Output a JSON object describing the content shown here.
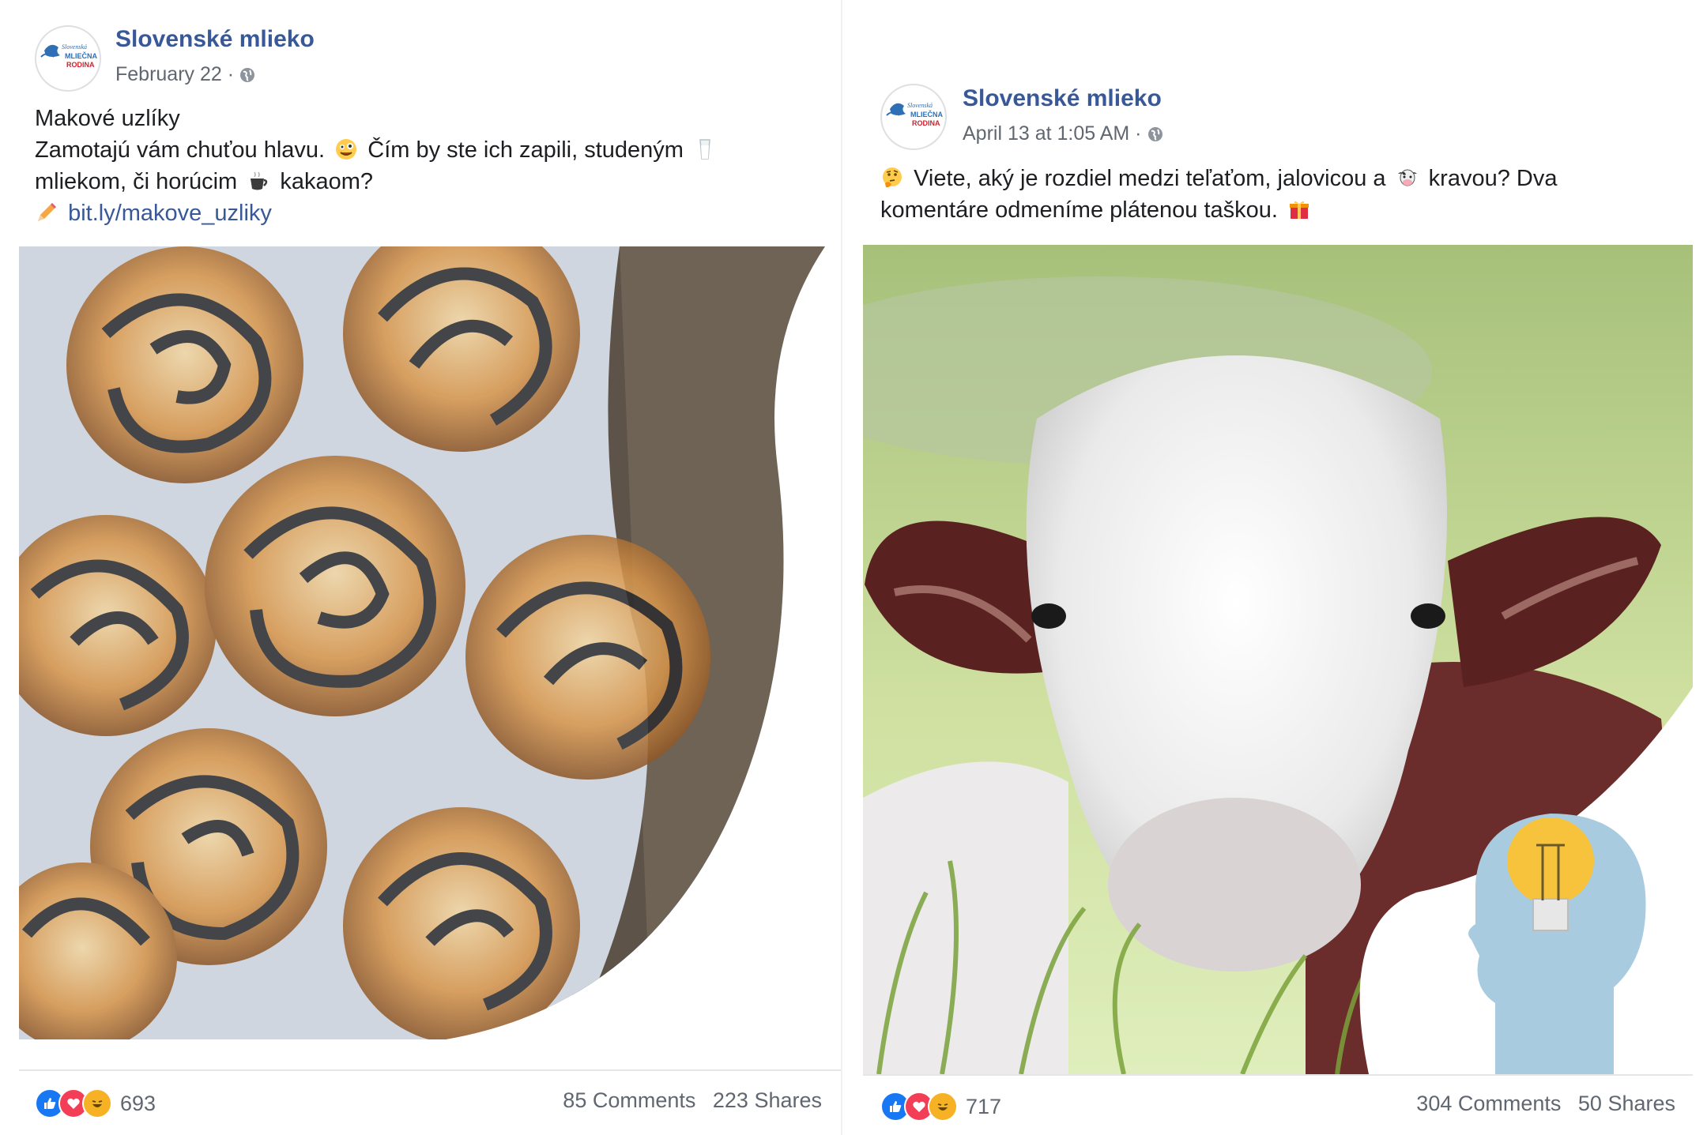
{
  "colors": {
    "link": "#385898",
    "meta": "#616770",
    "like": "#1877f2",
    "love": "#f33e58",
    "haha": "#f7b125"
  },
  "post1": {
    "page_name": "Slovenské mlieko",
    "date": "February 22 ·",
    "line1": "Makové uzlíky",
    "line2a": "Zamotajú vám chuťou hlavu.",
    "line2b": "Čím by ste ich zapili, studeným",
    "line3a": "mliekom, či horúcim",
    "line3b": "kakaom?",
    "link": "bit.ly/makove_uzliky",
    "reaction_count": "693",
    "comments": "85 Comments",
    "shares": "223 Shares"
  },
  "post2": {
    "page_name": "Slovenské mlieko",
    "date": "April 13 at 1:05 AM ·",
    "line1a": "Viete, aký je rozdiel medzi teľaťom, jalovicou a",
    "line1b": "kravou? Dva",
    "line2": "komentáre odmeníme plátenou taškou.",
    "reaction_count": "717",
    "comments": "304 Comments",
    "shares": "50 Shares"
  },
  "avatar_text": {
    "top": "Slovenská",
    "mid": "MLIEČNA",
    "bot": "RODINA"
  }
}
